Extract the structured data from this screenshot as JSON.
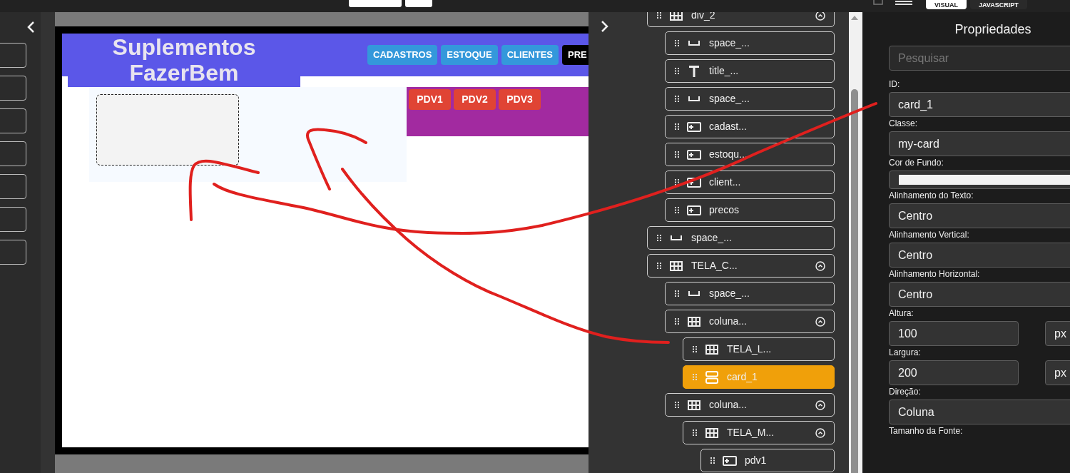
{
  "toolbar": {
    "tabs": [
      {
        "label": "VISUAL",
        "selected": true
      },
      {
        "label": "JAVASCRIPT",
        "selected": false
      }
    ]
  },
  "preview": {
    "title": "Suplementos FazerBem",
    "nav_buttons": [
      {
        "label": "CADASTROS",
        "color": "#3498db"
      },
      {
        "label": "ESTOQUE",
        "color": "#3498db"
      },
      {
        "label": "CLIENTES",
        "color": "#3498db"
      },
      {
        "label": "PRE",
        "color": "#000000"
      }
    ],
    "pdv_buttons": [
      "PDV1",
      "PDV2",
      "PDV3"
    ]
  },
  "tree": [
    {
      "label": "div_2",
      "kind": "grid",
      "expanded": true,
      "selected": false,
      "children": [
        {
          "label": "space_...",
          "kind": "space",
          "expanded": false,
          "selected": false
        },
        {
          "label": "title_...",
          "kind": "text",
          "expanded": false,
          "selected": false
        },
        {
          "label": "space_...",
          "kind": "space",
          "expanded": false,
          "selected": false
        },
        {
          "label": "cadast...",
          "kind": "button",
          "expanded": false,
          "selected": false
        },
        {
          "label": "estoqu...",
          "kind": "button",
          "expanded": false,
          "selected": false
        },
        {
          "label": "client...",
          "kind": "button",
          "expanded": false,
          "selected": false
        },
        {
          "label": "precos",
          "kind": "button",
          "expanded": false,
          "selected": false
        }
      ]
    },
    {
      "label": "space_...",
      "kind": "space",
      "expanded": false,
      "selected": false
    },
    {
      "label": "TELA_C...",
      "kind": "grid",
      "expanded": true,
      "selected": false,
      "children": [
        {
          "label": "space_...",
          "kind": "space",
          "expanded": false,
          "selected": false
        },
        {
          "label": "coluna...",
          "kind": "grid",
          "expanded": true,
          "selected": false,
          "children": [
            {
              "label": "TELA_L...",
              "kind": "grid",
              "expanded": false,
              "selected": false
            },
            {
              "label": "card_1",
              "kind": "card",
              "expanded": false,
              "selected": true
            }
          ]
        },
        {
          "label": "coluna...",
          "kind": "grid",
          "expanded": true,
          "selected": false,
          "children": [
            {
              "label": "TELA_M...",
              "kind": "grid",
              "expanded": true,
              "selected": false,
              "children": [
                {
                  "label": "pdv1",
                  "kind": "button",
                  "expanded": false,
                  "selected": false
                }
              ]
            }
          ]
        }
      ]
    }
  ],
  "properties": {
    "title": "Propriedades",
    "search": {
      "placeholder": "Pesquisar"
    },
    "fields": [
      {
        "kind": "text",
        "label": "ID:",
        "value": "card_1"
      },
      {
        "kind": "text",
        "label": "Classe:",
        "value": "my-card"
      },
      {
        "kind": "color",
        "label": "Cor de Fundo:",
        "color": "#f3f3f3"
      },
      {
        "kind": "select",
        "label": "Alinhamento do Texto:",
        "value": "Centro"
      },
      {
        "kind": "select",
        "label": "Alinhamento Vertical:",
        "value": "Centro"
      },
      {
        "kind": "select",
        "label": "Alinhamento Horizontal:",
        "value": "Centro"
      },
      {
        "kind": "number",
        "label": "Altura:",
        "value": "100",
        "unit": "px"
      },
      {
        "kind": "number",
        "label": "Largura:",
        "value": "200",
        "unit": "px"
      },
      {
        "kind": "select",
        "label": "Direção:",
        "value": "Coluna"
      },
      {
        "kind": "label",
        "label": "Tamanho da Fonte:"
      }
    ]
  }
}
